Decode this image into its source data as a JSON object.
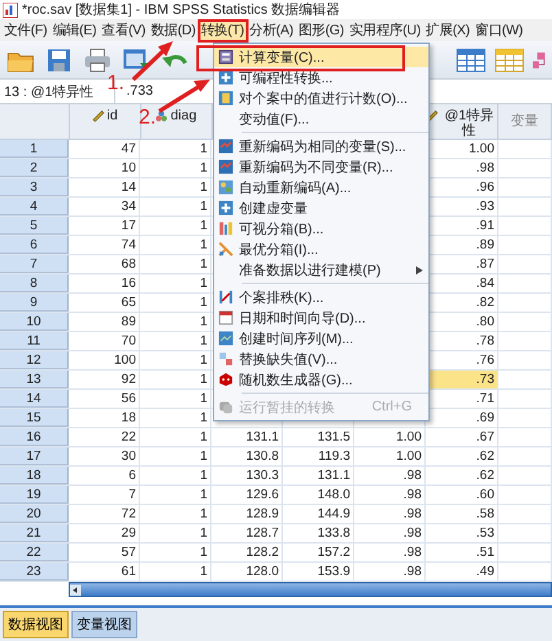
{
  "window": {
    "title": "*roc.sav [数据集1] - IBM SPSS Statistics 数据编辑器"
  },
  "menu_bar": [
    {
      "label": "文件(F)",
      "selected": false
    },
    {
      "label": "编辑(E)",
      "selected": false
    },
    {
      "label": "查看(V)",
      "selected": false
    },
    {
      "label": "数据(D)",
      "selected": false
    },
    {
      "label": "转换(T)",
      "selected": true
    },
    {
      "label": "分析(A)",
      "selected": false
    },
    {
      "label": "图形(G)",
      "selected": false
    },
    {
      "label": "实用程序(U)",
      "selected": false
    },
    {
      "label": "扩展(X)",
      "selected": false
    },
    {
      "label": "窗口(W)",
      "selected": false
    }
  ],
  "cell_editor": {
    "cell": "13 : @1特异性",
    "value": ".733"
  },
  "table": {
    "columns": [
      {
        "label": "id",
        "kind": "scale"
      },
      {
        "label": "diag",
        "kind": "nominal"
      },
      {
        "kind": "covered"
      },
      {
        "kind": "covered"
      },
      {
        "kind": "covered"
      },
      {
        "label": "@1特异性",
        "kind": "scale"
      },
      {
        "label": "变量",
        "kind": "empty"
      }
    ],
    "rows": [
      {
        "number": "1",
        "cells": [
          "47",
          "1",
          null,
          null,
          null,
          "1.00",
          null
        ],
        "selected": false
      },
      {
        "number": "2",
        "cells": [
          "10",
          "1",
          null,
          null,
          null,
          ".98",
          null
        ],
        "selected": false
      },
      {
        "number": "3",
        "cells": [
          "14",
          "1",
          null,
          null,
          null,
          ".96",
          null
        ],
        "selected": false
      },
      {
        "number": "4",
        "cells": [
          "34",
          "1",
          null,
          null,
          null,
          ".93",
          null
        ],
        "selected": false
      },
      {
        "number": "5",
        "cells": [
          "17",
          "1",
          null,
          null,
          null,
          ".91",
          null
        ],
        "selected": false
      },
      {
        "number": "6",
        "cells": [
          "74",
          "1",
          null,
          null,
          null,
          ".89",
          null
        ],
        "selected": false
      },
      {
        "number": "7",
        "cells": [
          "68",
          "1",
          null,
          null,
          null,
          ".87",
          null
        ],
        "selected": false
      },
      {
        "number": "8",
        "cells": [
          "16",
          "1",
          null,
          null,
          null,
          ".84",
          null
        ],
        "selected": false
      },
      {
        "number": "9",
        "cells": [
          "65",
          "1",
          null,
          null,
          null,
          ".82",
          null
        ],
        "selected": false
      },
      {
        "number": "10",
        "cells": [
          "89",
          "1",
          null,
          null,
          null,
          ".80",
          null
        ],
        "selected": false
      },
      {
        "number": "11",
        "cells": [
          "70",
          "1",
          null,
          null,
          null,
          ".78",
          null
        ],
        "selected": false
      },
      {
        "number": "12",
        "cells": [
          "100",
          "1",
          null,
          null,
          null,
          ".76",
          null
        ],
        "selected": false
      },
      {
        "number": "13",
        "cells": [
          "92",
          "1",
          null,
          null,
          null,
          ".73",
          null
        ],
        "selected": true
      },
      {
        "number": "14",
        "cells": [
          "56",
          "1",
          null,
          null,
          null,
          ".71",
          null
        ],
        "selected": false
      },
      {
        "number": "15",
        "cells": [
          "18",
          "1",
          null,
          null,
          null,
          ".69",
          null
        ],
        "selected": false
      },
      {
        "number": "16",
        "cells": [
          "22",
          "1",
          "131.1",
          "131.5",
          "1.00",
          ".67",
          null
        ],
        "selected": false
      },
      {
        "number": "17",
        "cells": [
          "30",
          "1",
          "130.8",
          "119.3",
          "1.00",
          ".62",
          null
        ],
        "selected": false
      },
      {
        "number": "18",
        "cells": [
          "6",
          "1",
          "130.3",
          "131.1",
          ".98",
          ".62",
          null
        ],
        "selected": false
      },
      {
        "number": "19",
        "cells": [
          "7",
          "1",
          "129.6",
          "148.0",
          ".98",
          ".60",
          null
        ],
        "selected": false
      },
      {
        "number": "20",
        "cells": [
          "72",
          "1",
          "128.9",
          "144.9",
          ".98",
          ".58",
          null
        ],
        "selected": false
      },
      {
        "number": "21",
        "cells": [
          "29",
          "1",
          "128.7",
          "133.8",
          ".98",
          ".53",
          null
        ],
        "selected": false
      },
      {
        "number": "22",
        "cells": [
          "57",
          "1",
          "128.2",
          "157.2",
          ".98",
          ".51",
          null
        ],
        "selected": false
      },
      {
        "number": "23",
        "cells": [
          "61",
          "1",
          "128.0",
          "153.9",
          ".98",
          ".49",
          null
        ],
        "selected": false
      }
    ]
  },
  "transform_menu": {
    "items": [
      {
        "kind": "item",
        "label": "计算变量(C)...",
        "selected": true,
        "disabled": false
      },
      {
        "kind": "item",
        "label": "可编程性转换...",
        "selected": false,
        "disabled": false
      },
      {
        "kind": "item",
        "label": "对个案中的值进行计数(O)...",
        "selected": false,
        "disabled": false
      },
      {
        "kind": "item",
        "label": "变动值(F)...",
        "selected": false,
        "disabled": false
      },
      {
        "kind": "separator"
      },
      {
        "kind": "item",
        "label": "重新编码为相同的变量(S)...",
        "selected": false,
        "disabled": false
      },
      {
        "kind": "item",
        "label": "重新编码为不同变量(R)...",
        "selected": false,
        "disabled": false
      },
      {
        "kind": "item",
        "label": "自动重新编码(A)...",
        "selected": false,
        "disabled": false
      },
      {
        "kind": "item",
        "label": "创建虚变量",
        "selected": false,
        "disabled": false
      },
      {
        "kind": "item",
        "label": "可视分箱(B)...",
        "selected": false,
        "disabled": false
      },
      {
        "kind": "item",
        "label": "最优分箱(I)...",
        "selected": false,
        "disabled": false
      },
      {
        "kind": "submenu",
        "label": "准备数据以进行建模(P)",
        "selected": false,
        "disabled": false
      },
      {
        "kind": "separator"
      },
      {
        "kind": "item",
        "label": "个案排秩(K)...",
        "selected": false,
        "disabled": false
      },
      {
        "kind": "item",
        "label": "日期和时间向导(D)...",
        "selected": false,
        "disabled": false
      },
      {
        "kind": "item",
        "label": "创建时间序列(M)...",
        "selected": false,
        "disabled": false
      },
      {
        "kind": "item",
        "label": "替换缺失值(V)...",
        "selected": false,
        "disabled": false
      },
      {
        "kind": "item",
        "label": "随机数生成器(G)...",
        "selected": false,
        "disabled": false
      },
      {
        "kind": "separator"
      },
      {
        "kind": "item",
        "label": "运行暂挂的转换",
        "shortcut": "Ctrl+G",
        "selected": false,
        "disabled": true
      }
    ]
  },
  "annotations": [
    {
      "label": "1."
    },
    {
      "label": "2."
    }
  ],
  "view_tabs": [
    {
      "label": "数据视图",
      "selected": true
    },
    {
      "label": "变量视图",
      "selected": false
    }
  ]
}
